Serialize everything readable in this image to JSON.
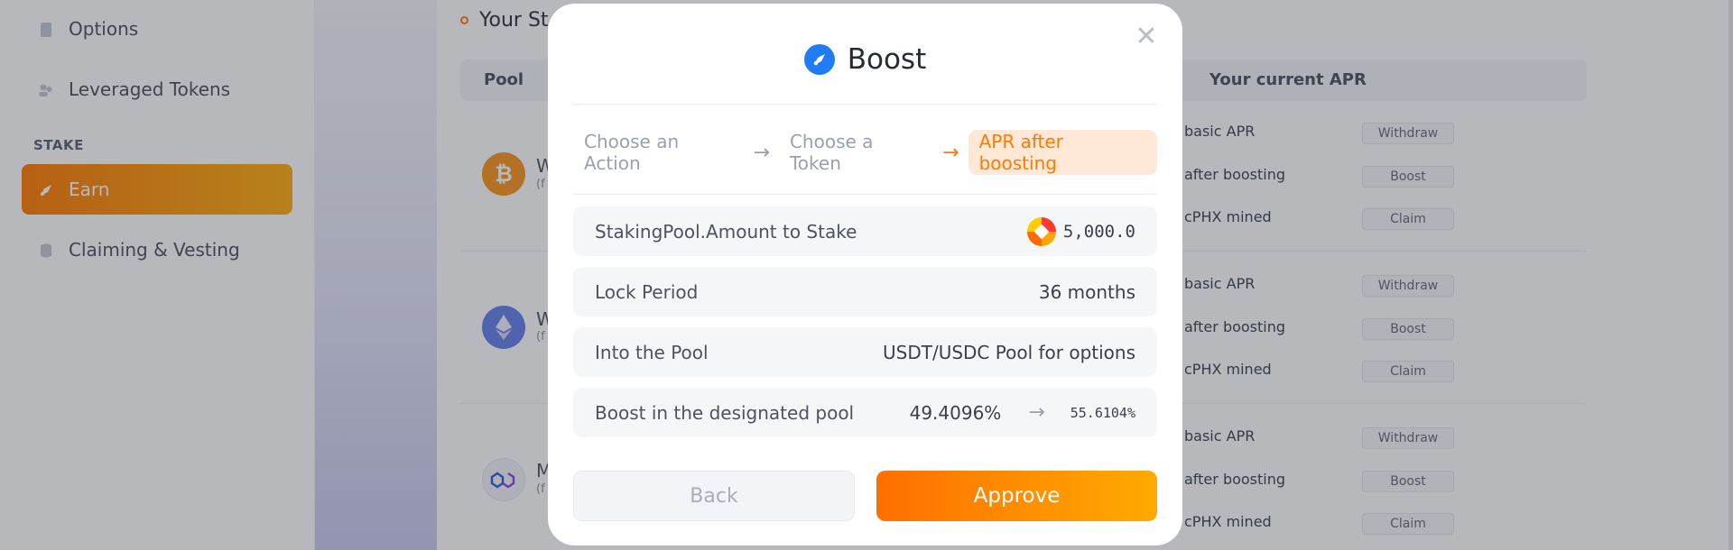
{
  "sidebar": {
    "items": [
      {
        "label": "Options",
        "icon": "document-icon"
      },
      {
        "label": "Leveraged Tokens",
        "icon": "users-icon"
      }
    ],
    "section_label": "STAKE",
    "stake_items": [
      {
        "label": "Earn",
        "icon": "rocket-icon",
        "active": true
      },
      {
        "label": "Claiming & Vesting",
        "icon": "database-icon"
      }
    ]
  },
  "main": {
    "title": "Your St",
    "columns": {
      "pool": "Pool",
      "apr": "Your current APR"
    },
    "rows": [
      {
        "icon": "bitcoin-icon",
        "letter": "W",
        "sub": "(f",
        "apr_labels": [
          "basic APR",
          "after boosting",
          "cPHX mined"
        ],
        "buttons": [
          "Withdraw",
          "Boost",
          "Claim"
        ]
      },
      {
        "icon": "ethereum-icon",
        "letter": "W",
        "sub": "(f",
        "apr_labels": [
          "basic APR",
          "after boosting",
          "cPHX mined"
        ],
        "buttons": [
          "Withdraw",
          "Boost",
          "Claim"
        ]
      },
      {
        "icon": "polygon-icon",
        "letter": "M",
        "sub": "(f",
        "apr_labels": [
          "basic APR",
          "after boosting",
          "cPHX mined"
        ],
        "buttons": [
          "Withdraw",
          "Boost",
          "Claim"
        ]
      }
    ]
  },
  "modal": {
    "title": "Boost",
    "close_glyph": "✕",
    "steps": [
      "Choose an Action",
      "Choose a Token",
      "APR after boosting"
    ],
    "active_step": 2,
    "rows": {
      "stake": {
        "label": "StakingPool.Amount to Stake",
        "value": "5,000.0"
      },
      "lock": {
        "label": "Lock Period",
        "value": "36 months"
      },
      "pool": {
        "label": "Into the Pool",
        "value": "USDT/USDC Pool for options"
      },
      "boost": {
        "label": "Boost in the designated pool",
        "from": "49.4096%",
        "to": "55.6104%"
      }
    },
    "back_label": "Back",
    "approve_label": "Approve"
  },
  "colors": {
    "accent": "#ff7a00",
    "accent_end": "#ffad0d",
    "brand_blue": "#1f7cf2",
    "btc": "#f7931a",
    "eth": "#627eea"
  }
}
